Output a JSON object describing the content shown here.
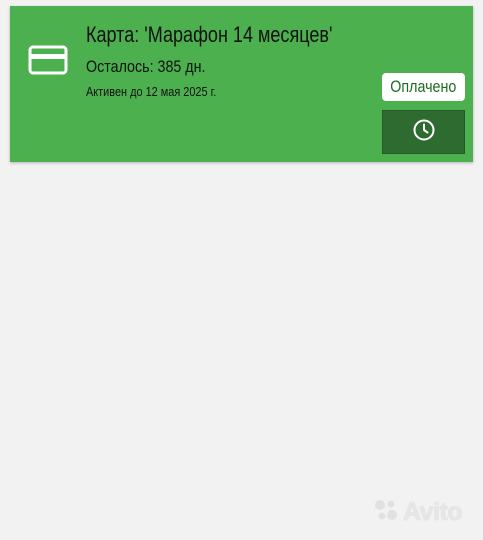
{
  "card": {
    "title": "Карта: 'Марафон 14 месяцев'",
    "remaining": "Осталось: 385 дн.",
    "active_until": "Активен до 12 мая 2025 г.",
    "status_badge": "Оплачено",
    "icon": "credit-card-icon",
    "action_icon": "clock-icon"
  },
  "watermark": {
    "text": "Avito"
  },
  "colors": {
    "card_background": "#4cb04f",
    "button_dark": "#2e6b31",
    "badge_text": "#1e6b22",
    "page_background": "#f2f2f2"
  }
}
